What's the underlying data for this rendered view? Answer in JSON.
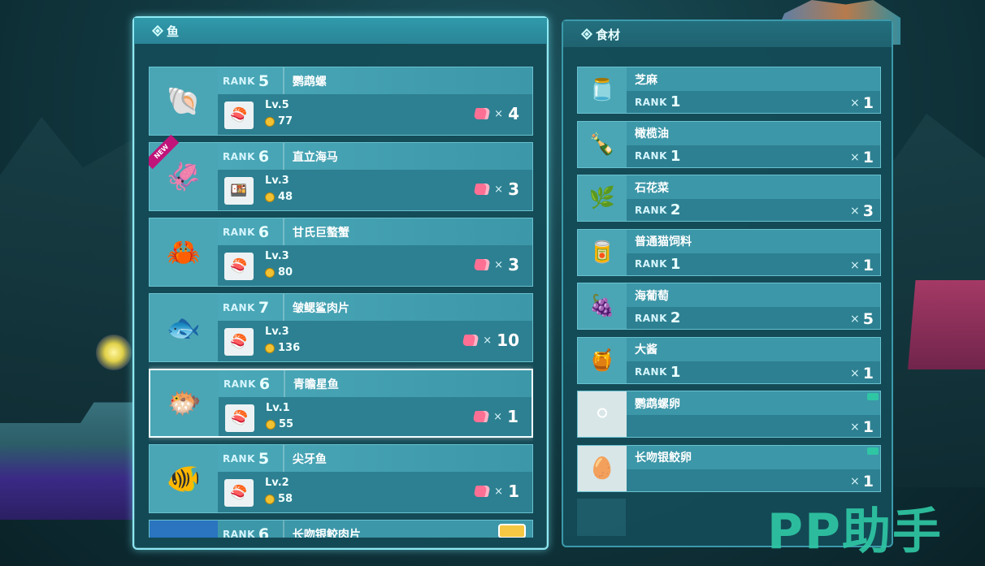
{
  "fish_panel": {
    "title": "鱼"
  },
  "ingredient_panel": {
    "title": "食材"
  },
  "fish": [
    {
      "rank_word": "RANK",
      "rank": "5",
      "name": "鹦鹉螺",
      "lv": "Lv.5",
      "price": "77",
      "qty_x": "×",
      "qty": "4",
      "icon": "nautilus-icon",
      "glyph": "🐚",
      "dish_glyph": "🍣"
    },
    {
      "rank_word": "RANK",
      "rank": "6",
      "name": "直立海马",
      "lv": "Lv.3",
      "price": "48",
      "qty_x": "×",
      "qty": "3",
      "icon": "seahorse-icon",
      "glyph": "🦑",
      "dish_glyph": "🍱",
      "is_new": true,
      "new_label": "NEW"
    },
    {
      "rank_word": "RANK",
      "rank": "6",
      "name": "甘氏巨螯蟹",
      "lv": "Lv.3",
      "price": "80",
      "qty_x": "×",
      "qty": "3",
      "icon": "crab-icon",
      "glyph": "🦀",
      "dish_glyph": "🍣"
    },
    {
      "rank_word": "RANK",
      "rank": "7",
      "name": "皱鳃鲨肉片",
      "lv": "Lv.3",
      "price": "136",
      "qty_x": "×",
      "qty": "10",
      "icon": "shark-meat-icon",
      "glyph": "🐟",
      "dish_glyph": "🍣"
    },
    {
      "rank_word": "RANK",
      "rank": "6",
      "name": "青瞻星鱼",
      "lv": "Lv.1",
      "price": "55",
      "qty_x": "×",
      "qty": "1",
      "icon": "stargazer-fish-icon",
      "glyph": "🐡",
      "dish_glyph": "🍣",
      "selected": true
    },
    {
      "rank_word": "RANK",
      "rank": "5",
      "name": "尖牙鱼",
      "lv": "Lv.2",
      "price": "58",
      "qty_x": "×",
      "qty": "1",
      "icon": "fangtooth-fish-icon",
      "glyph": "🐠",
      "dish_glyph": "🍣"
    }
  ],
  "partial_fish": {
    "rank_word": "RANK",
    "rank": "6",
    "name": "长吻银鲛肉片"
  },
  "ingredients": [
    {
      "name": "芝麻",
      "rank_word": "RANK",
      "rank": "1",
      "qty_x": "×",
      "qty": "1",
      "icon": "sesame-jar-icon",
      "glyph": "🫙"
    },
    {
      "name": "橄榄油",
      "rank_word": "RANK",
      "rank": "1",
      "qty_x": "×",
      "qty": "1",
      "icon": "olive-oil-bottle-icon",
      "glyph": "🍾"
    },
    {
      "name": "石花菜",
      "rank_word": "RANK",
      "rank": "2",
      "qty_x": "×",
      "qty": "3",
      "icon": "red-seaweed-icon",
      "glyph": "🌿"
    },
    {
      "name": "普通猫饲料",
      "rank_word": "RANK",
      "rank": "1",
      "qty_x": "×",
      "qty": "1",
      "icon": "cat-food-can-icon",
      "glyph": "🥫"
    },
    {
      "name": "海葡萄",
      "rank_word": "RANK",
      "rank": "2",
      "qty_x": "×",
      "qty": "5",
      "icon": "sea-grapes-icon",
      "glyph": "🍇"
    },
    {
      "name": "大酱",
      "rank_word": "RANK",
      "rank": "1",
      "qty_x": "×",
      "qty": "1",
      "icon": "miso-jar-icon",
      "glyph": "🍯"
    },
    {
      "name": "鹦鹉螺卵",
      "rank_word": "",
      "rank": "",
      "qty_x": "×",
      "qty": "1",
      "icon": "nautilus-eggs-icon",
      "glyph": "⚪"
    },
    {
      "name": "长吻银鲛卵",
      "rank_word": "",
      "rank": "",
      "qty_x": "×",
      "qty": "1",
      "icon": "chimaera-egg-icon",
      "glyph": "🥚"
    }
  ],
  "watermark": "PP助手",
  "colors": {
    "panel_border": "#8ee9f4",
    "card_bg": "#3c97a8",
    "meat_pink": "#ff6f94",
    "coin_gold": "#f1c232"
  }
}
